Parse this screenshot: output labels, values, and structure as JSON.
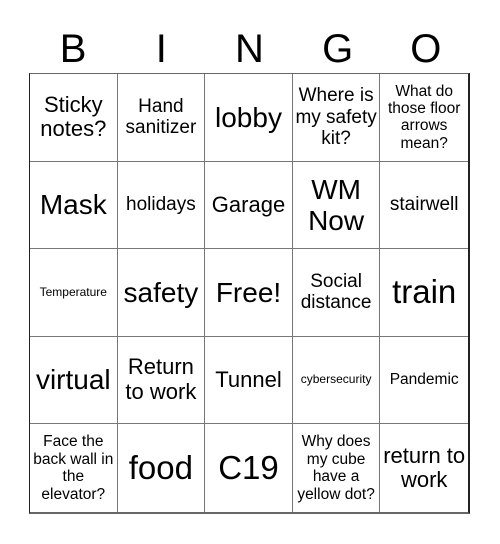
{
  "header": {
    "letters": [
      "B",
      "I",
      "N",
      "G",
      "O"
    ]
  },
  "cells": [
    [
      "Sticky notes?",
      "Hand sanitizer",
      "lobby",
      "Where is my safety kit?",
      "What do those floor arrows mean?"
    ],
    [
      "Mask",
      "holidays",
      "Garage",
      "WM Now",
      "stairwell"
    ],
    [
      "Temperature",
      "safety",
      "Free!",
      "Social distance",
      "train"
    ],
    [
      "virtual",
      "Return to work",
      "Tunnel",
      "cybersecurity",
      "Pandemic"
    ],
    [
      "Face the back wall in the elevator?",
      "food",
      "C19",
      "Why does my cube have a yellow dot?",
      "return to work"
    ]
  ]
}
